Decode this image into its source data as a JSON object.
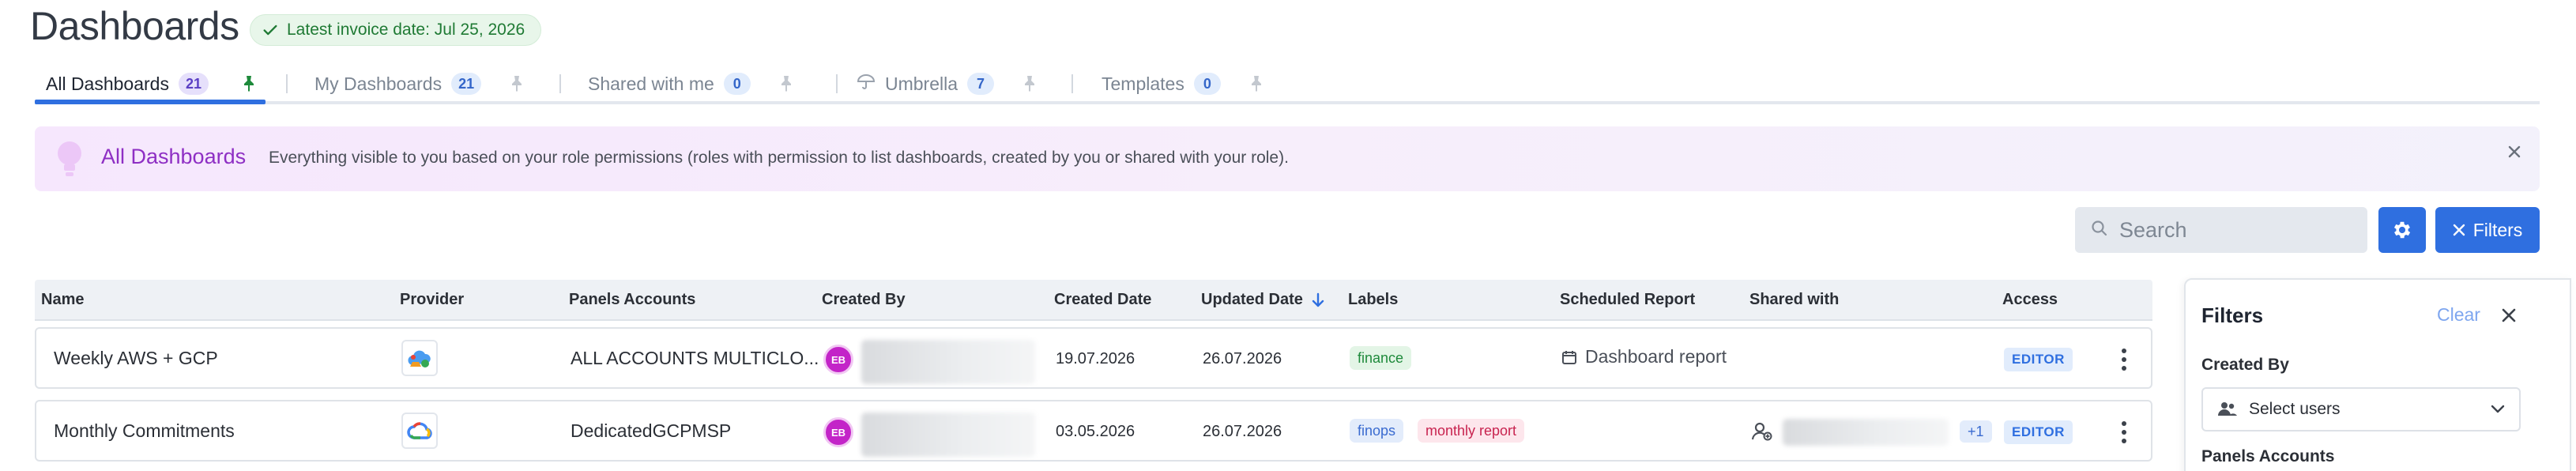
{
  "header": {
    "title": "Dashboards",
    "invoice_badge": "Latest invoice date: Jul 25, 2026"
  },
  "tabs": [
    {
      "label": "All Dashboards",
      "count": "21"
    },
    {
      "label": "My Dashboards",
      "count": "21"
    },
    {
      "label": "Shared with me",
      "count": "0"
    },
    {
      "label": "Umbrella",
      "count": "7"
    },
    {
      "label": "Templates",
      "count": "0"
    }
  ],
  "banner": {
    "title": "All Dashboards",
    "text": "Everything visible to you based on your role permissions (roles with permission to list dashboards, created by you or shared with your role)."
  },
  "toolbar": {
    "search_placeholder": "Search",
    "filters_label": "Filters"
  },
  "table": {
    "columns": [
      "Name",
      "Provider",
      "Panels Accounts",
      "Created By",
      "Created Date",
      "Updated Date",
      "Labels",
      "Scheduled Report",
      "Shared with",
      "Access"
    ],
    "rows": [
      {
        "name": "Weekly AWS + GCP",
        "provider": "multicloud",
        "panels_accounts": "ALL ACCOUNTS MULTICLO...",
        "created_by_initials": "EB",
        "created_date": "19.07.2026",
        "updated_date": "26.07.2026",
        "labels": [
          "finance"
        ],
        "scheduled_report": "Dashboard report",
        "access": "EDITOR"
      },
      {
        "name": "Monthly Commitments",
        "provider": "gcp",
        "panels_accounts": "DedicatedGCPMSP",
        "created_by_initials": "EB",
        "created_date": "03.05.2026",
        "updated_date": "26.07.2026",
        "labels": [
          "finops",
          "monthly report"
        ],
        "scheduled_report": "",
        "shared_extra": "+1",
        "access": "EDITOR"
      }
    ]
  },
  "filters_panel": {
    "title": "Filters",
    "clear_label": "Clear",
    "created_by_label": "Created By",
    "created_by_placeholder": "Select users",
    "panels_accounts_label": "Panels Accounts"
  },
  "colors": {
    "primary": "#2f6fe0",
    "banner_title": "#8e2fc4",
    "avatar": "#c324c8",
    "pin_active": "#1e8a3b"
  }
}
